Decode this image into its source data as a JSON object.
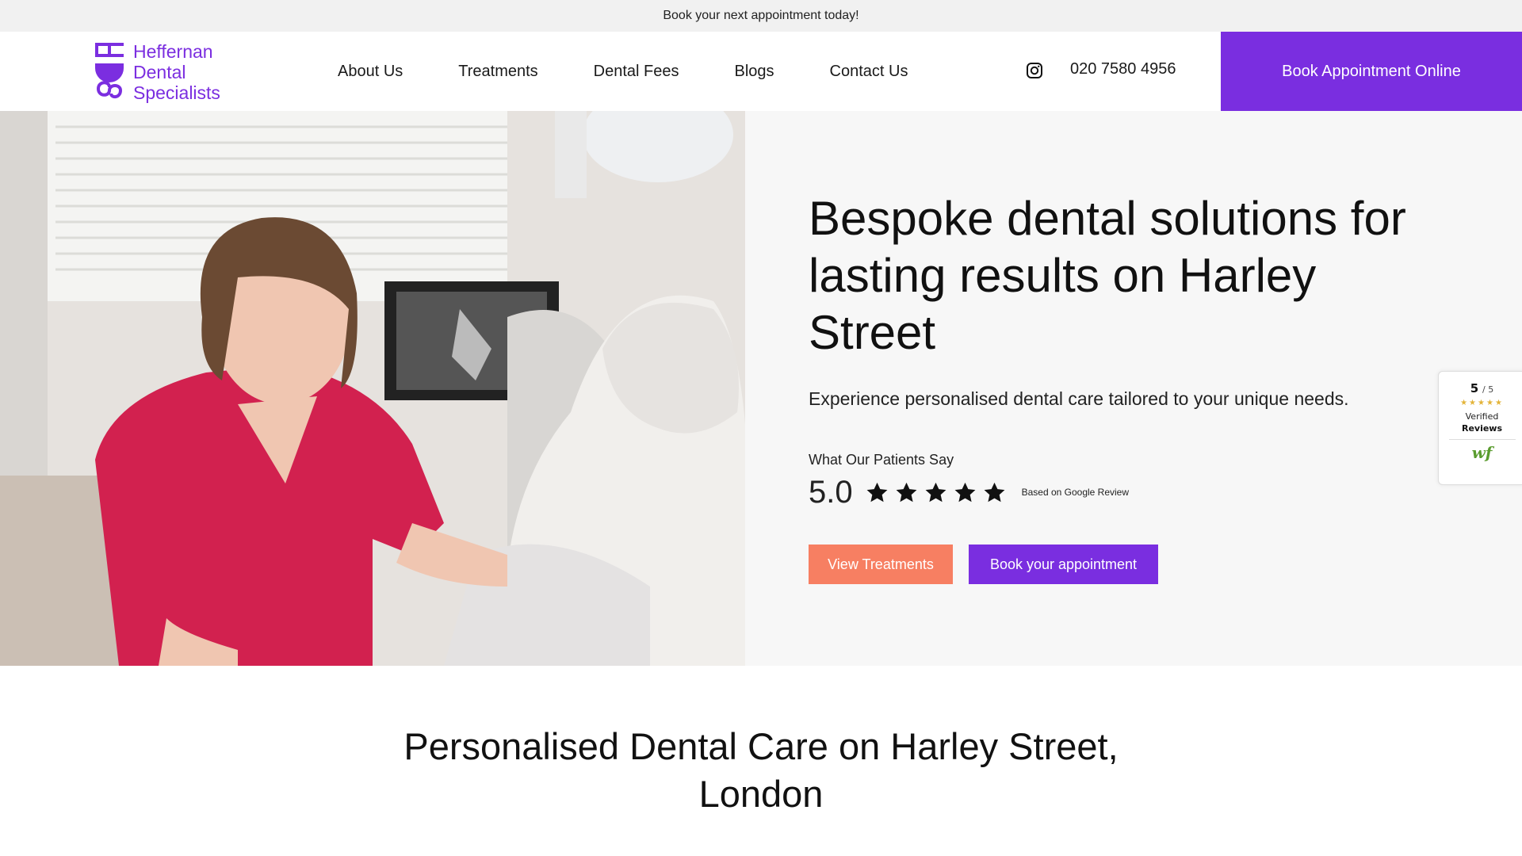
{
  "topbar": {
    "text": "Book your next appointment today!"
  },
  "header": {
    "logo_lines": [
      "Heffernan",
      "Dental",
      "Specialists"
    ],
    "nav": [
      {
        "label": "About Us"
      },
      {
        "label": "Treatments"
      },
      {
        "label": "Dental Fees"
      },
      {
        "label": "Blogs"
      },
      {
        "label": "Contact Us"
      }
    ],
    "social_icon": "instagram-icon",
    "phone": "020 7580 4956",
    "cta": "Book Appointment Online"
  },
  "hero": {
    "title": "Bespoke dental solutions for lasting results on Harley Street",
    "subtitle": "Experience personalised dental care tailored to your unique needs.",
    "patients_label": "What Our Patients Say",
    "rating": "5.0",
    "stars": 5,
    "based_on": "Based on Google Review",
    "btn_treatments": "View Treatments",
    "btn_appointment": "Book your appointment"
  },
  "review_widget": {
    "score": "5",
    "out_of": "/ 5",
    "stars": "★★★★★",
    "verified": "Verified",
    "reviews": "Reviews",
    "logo": "wf"
  },
  "section": {
    "title_line1": "Personalised Dental Care on Harley Street,",
    "title_line2": "London"
  },
  "colors": {
    "brand_purple": "#7a2ee0",
    "coral": "#f77f62",
    "hero_bg": "#f7f7f7",
    "topbar_bg": "#f1f1f1"
  }
}
